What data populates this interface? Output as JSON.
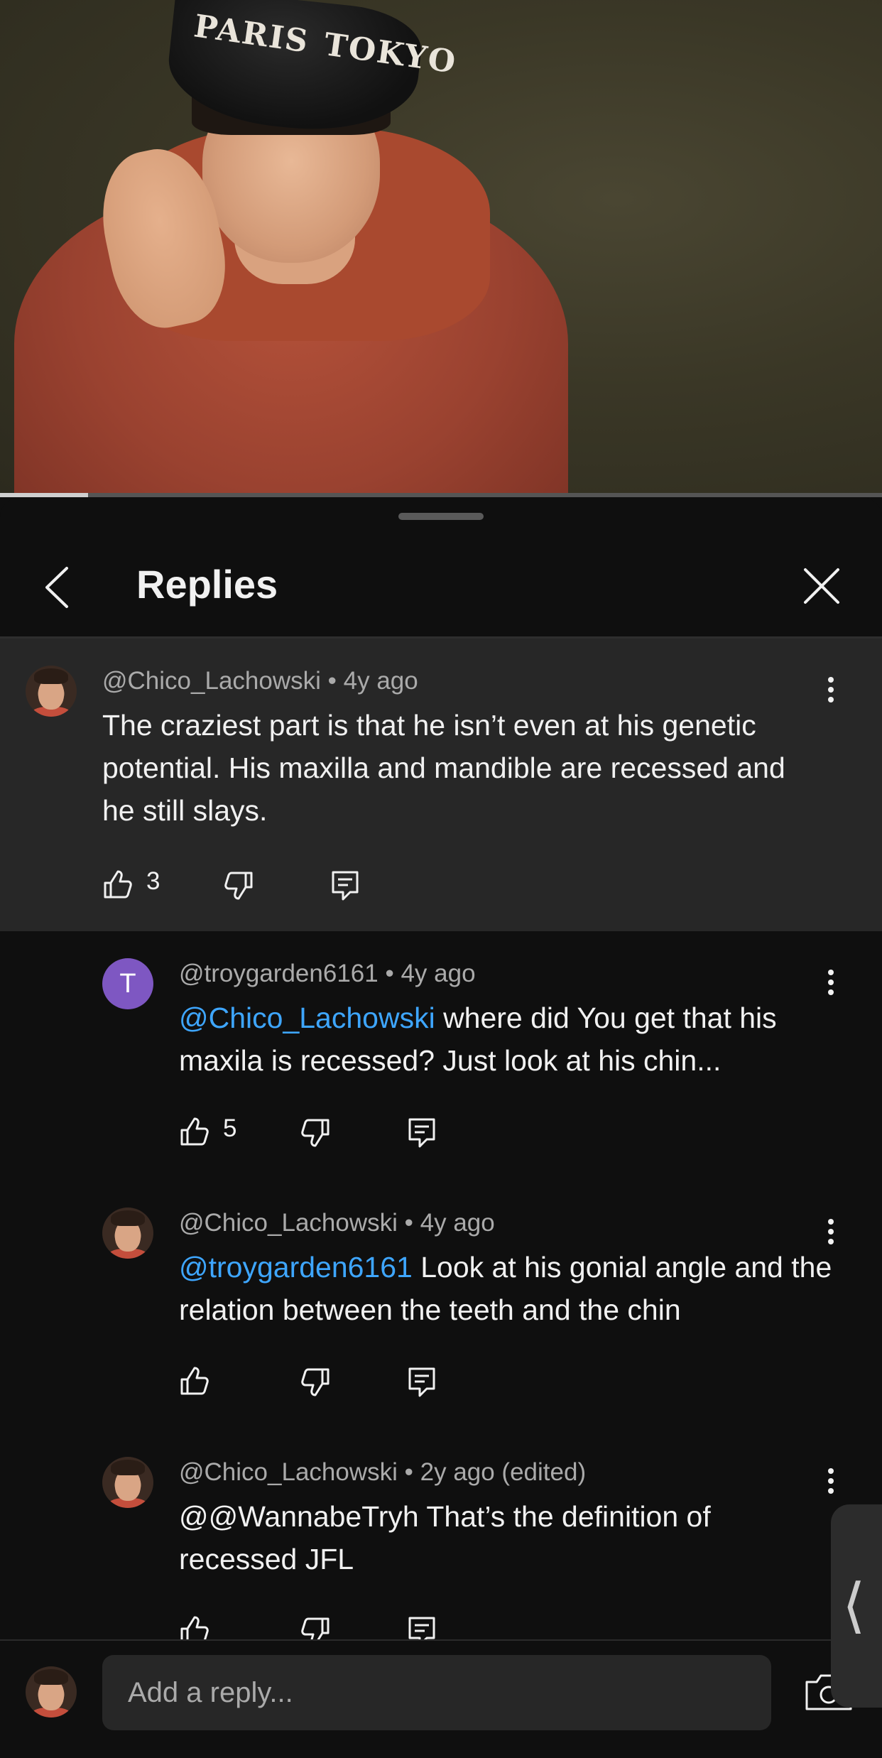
{
  "video": {
    "cap_words": [
      "PARIS",
      "TOKYO"
    ],
    "progress_fraction": 0.1
  },
  "sheet": {
    "title": "Replies"
  },
  "parent_comment": {
    "handle": "@Chico_Lachowski",
    "separator": "•",
    "time": "4y ago",
    "text": "The craziest part is that he isn’t even at his genetic potential. His maxilla and mandible are recessed and he still slays.",
    "likes": "3"
  },
  "replies": [
    {
      "handle": "@troygarden6161",
      "separator": "•",
      "time": "4y ago",
      "avatar_letter": "T",
      "mention": "@Chico_Lachowski",
      "text": " where did You get that his maxila is recessed? Just look at his chin...",
      "likes": "5"
    },
    {
      "handle": "@Chico_Lachowski",
      "separator": "•",
      "time": "4y ago",
      "mention": "@troygarden6161",
      "text": " Look at his gonial angle and the relation between the teeth and the chin",
      "likes": ""
    },
    {
      "handle": "@Chico_Lachowski",
      "separator": "•",
      "time": "2y ago (edited)",
      "mention": "",
      "text": "@@WannabeTryh That’s the definition of recessed JFL",
      "likes": ""
    }
  ],
  "composer": {
    "placeholder": "Add a reply..."
  },
  "side_tab": {
    "glyph": "⟨"
  },
  "colors": {
    "background": "#0f0f0f",
    "highlight": "#272727",
    "mention": "#3ea6ff",
    "avatar_purple": "#7e57c2",
    "meta_text": "#aaaaaa"
  },
  "icons": [
    "chevron-left-icon",
    "close-icon",
    "kebab-menu-icon",
    "thumbs-up-icon",
    "thumbs-down-icon",
    "reply-icon",
    "camera-icon"
  ]
}
